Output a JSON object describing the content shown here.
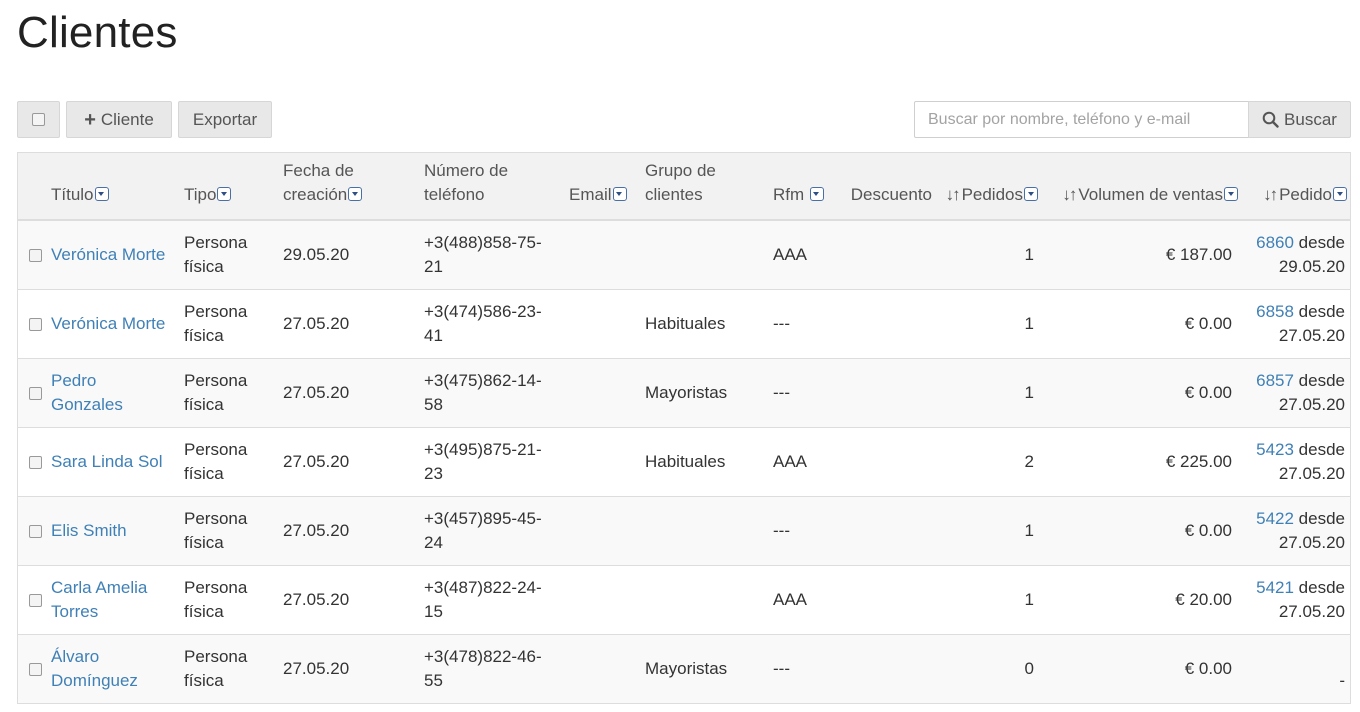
{
  "page": {
    "title": "Clientes"
  },
  "toolbar": {
    "add_label": "Cliente",
    "export_label": "Exportar",
    "search_placeholder": "Buscar por nombre, teléfono y e-mail",
    "search_label": "Buscar"
  },
  "columns": {
    "title": "Título",
    "type": "Tipo",
    "date_line1": "Fecha de",
    "date_line2": "creación",
    "phone_line1": "Número de",
    "phone_line2": "teléfono",
    "email": "Email",
    "group_line1": "Grupo de",
    "group_line2": "clientes",
    "rfm": "Rfm",
    "discount": "Descuento",
    "orders": "Pedidos",
    "sales": "Volumen de ventas",
    "order": "Pedido"
  },
  "rows": [
    {
      "name_1": "Verónica Morte",
      "name_2": "",
      "type_1": "Persona",
      "type_2": "física",
      "date": "29.05.20",
      "phone_1": "+3(488)858-75-",
      "phone_2": "21",
      "email": "",
      "group": "",
      "rfm": "AAA",
      "discount": "",
      "orders": "1",
      "sales": "€ 187.00",
      "order_no": "6860",
      "order_from": "desde",
      "order_date": "29.05.20"
    },
    {
      "name_1": "Verónica Morte",
      "name_2": "",
      "type_1": "Persona",
      "type_2": "física",
      "date": "27.05.20",
      "phone_1": "+3(474)586-23-",
      "phone_2": "41",
      "email": "",
      "group": "Habituales",
      "rfm": "---",
      "discount": "",
      "orders": "1",
      "sales": "€ 0.00",
      "order_no": "6858",
      "order_from": "desde",
      "order_date": "27.05.20"
    },
    {
      "name_1": "Pedro",
      "name_2": "Gonzales",
      "type_1": "Persona",
      "type_2": "física",
      "date": "27.05.20",
      "phone_1": "+3(475)862-14-",
      "phone_2": "58",
      "email": "",
      "group": "Mayoristas",
      "rfm": "---",
      "discount": "",
      "orders": "1",
      "sales": "€ 0.00",
      "order_no": "6857",
      "order_from": "desde",
      "order_date": "27.05.20"
    },
    {
      "name_1": "Sara Linda Sol",
      "name_2": "",
      "type_1": "Persona",
      "type_2": "física",
      "date": "27.05.20",
      "phone_1": "+3(495)875-21-",
      "phone_2": "23",
      "email": "",
      "group": "Habituales",
      "rfm": "AAA",
      "discount": "",
      "orders": "2",
      "sales": "€ 225.00",
      "order_no": "5423",
      "order_from": "desde",
      "order_date": "27.05.20"
    },
    {
      "name_1": "Elis Smith",
      "name_2": "",
      "type_1": "Persona",
      "type_2": "física",
      "date": "27.05.20",
      "phone_1": "+3(457)895-45-",
      "phone_2": "24",
      "email": "",
      "group": "",
      "rfm": "---",
      "discount": "",
      "orders": "1",
      "sales": "€ 0.00",
      "order_no": "5422",
      "order_from": "desde",
      "order_date": "27.05.20"
    },
    {
      "name_1": "Carla Amelia",
      "name_2": "Torres",
      "type_1": "Persona",
      "type_2": "física",
      "date": "27.05.20",
      "phone_1": "+3(487)822-24-",
      "phone_2": "15",
      "email": "",
      "group": "",
      "rfm": "AAA",
      "discount": "",
      "orders": "1",
      "sales": "€ 20.00",
      "order_no": "5421",
      "order_from": "desde",
      "order_date": "27.05.20"
    },
    {
      "name_1": "Álvaro",
      "name_2": "Domínguez",
      "type_1": "Persona",
      "type_2": "física",
      "date": "27.05.20",
      "phone_1": "+3(478)822-46-",
      "phone_2": "55",
      "email": "",
      "group": "Mayoristas",
      "rfm": "---",
      "discount": "",
      "orders": "0",
      "sales": "€ 0.00",
      "order_no": "",
      "order_from": "",
      "order_date": "-"
    }
  ]
}
